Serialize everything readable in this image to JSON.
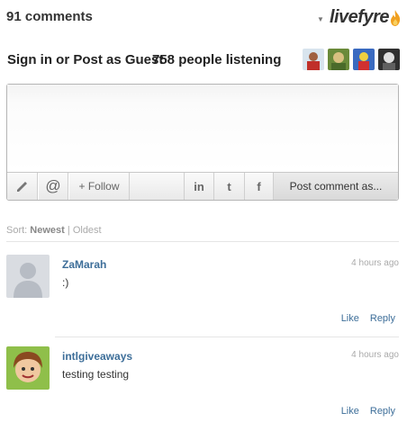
{
  "header": {
    "comment_count": "91 comments",
    "brand": "livefyre"
  },
  "signin": {
    "text": "Sign in or Post as Guest",
    "listening": "758 people listening"
  },
  "composer": {
    "textarea_value": "",
    "follow_label": "+ Follow",
    "linkedin_label": "in",
    "twitter_label": "t",
    "facebook_label": "f",
    "post_label": "Post comment as..."
  },
  "sort": {
    "label": "Sort:",
    "newest": "Newest",
    "separator": "|",
    "oldest": "Oldest"
  },
  "comments": [
    {
      "author": "ZaMarah",
      "time": "4 hours ago",
      "body": ":)",
      "like": "Like",
      "reply": "Reply"
    },
    {
      "author": "intlgiveaways",
      "time": "4 hours ago",
      "body": "testing testing",
      "like": "Like",
      "reply": "Reply"
    }
  ],
  "colors": {
    "link": "#3d6e99",
    "brand_flame": "#f0a020",
    "muted": "#aaaaaa"
  }
}
